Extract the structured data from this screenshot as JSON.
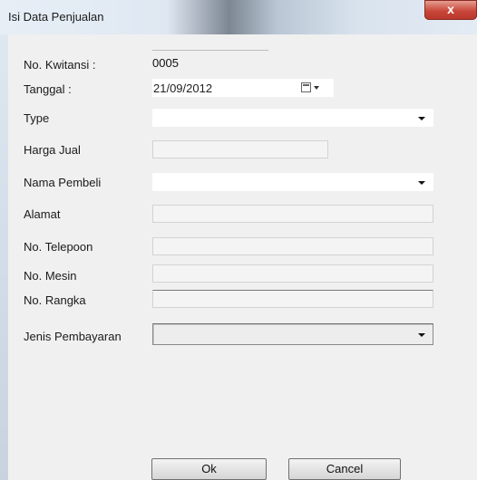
{
  "window": {
    "title": "Isi Data Penjualan",
    "close_glyph": "x"
  },
  "form": {
    "kwitansi_label": "No. Kwitansi :",
    "kwitansi_value": "0005",
    "tanggal_label": "Tanggal :",
    "tanggal_value": "21/09/2012",
    "type_label": "Type",
    "type_value": "",
    "harga_label": "Harga Jual",
    "harga_value": "",
    "nama_label": "Nama Pembeli",
    "nama_value": "",
    "alamat_label": "Alamat",
    "alamat_value": "",
    "telepon_label": "No. Telepoon",
    "telepon_value": "",
    "mesin_label": "No. Mesin",
    "mesin_value": "",
    "rangka_label": "No. Rangka",
    "rangka_value": "",
    "pembayaran_label": "Jenis Pembayaran",
    "pembayaran_value": ""
  },
  "buttons": {
    "ok_label": "Ok",
    "cancel_label": "Cancel"
  },
  "icons": {
    "calendar": "calendar-icon",
    "dropdown": "chevron-down-icon",
    "close": "close-icon"
  }
}
